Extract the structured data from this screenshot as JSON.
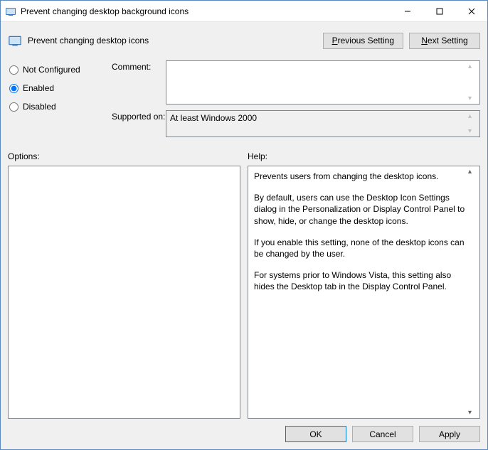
{
  "title": "Prevent changing desktop background icons",
  "subtitle": "Prevent changing desktop icons",
  "nav": {
    "prev": "Previous Setting",
    "next": "Next Setting",
    "prev_u": "P",
    "next_u": "N",
    "prev_rest": "revious Setting",
    "next_rest": "ext Setting"
  },
  "radios": {
    "not_configured": "Not Configured",
    "enabled": "Enabled",
    "disabled": "Disabled",
    "selected": "enabled"
  },
  "labels": {
    "comment": "Comment:",
    "supported": "Supported on:",
    "options": "Options:",
    "help": "Help:"
  },
  "comment": "",
  "supported_on": "At least Windows 2000",
  "options_text": "",
  "help_paragraphs": [
    "Prevents users from changing the desktop icons.",
    "By default, users can use the Desktop Icon Settings dialog in the Personalization or Display Control Panel to show, hide, or change the desktop icons.",
    "If you enable this setting, none of the desktop icons can be changed by the user.",
    "For systems prior to Windows Vista, this setting also hides the Desktop tab in the Display Control Panel."
  ],
  "footer": {
    "ok": "OK",
    "cancel": "Cancel",
    "apply": "Apply"
  }
}
